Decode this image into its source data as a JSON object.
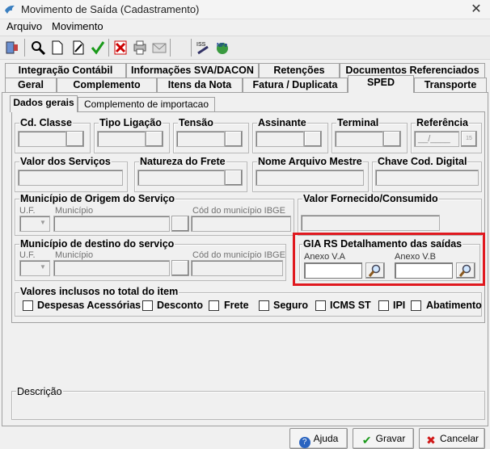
{
  "window": {
    "title": "Movimento de Saída (Cadastramento)",
    "close_glyph": "✕"
  },
  "menu": [
    "Arquivo",
    "Movimento"
  ],
  "toolbar": {
    "icons": [
      "exit-icon",
      "search-icon",
      "new-doc-icon",
      "edit-icon",
      "confirm-icon",
      "delete-icon",
      "print-icon",
      "mail-icon",
      "blank-icon",
      "iss-icon",
      "nfe-icon"
    ],
    "iss_label": "ISS",
    "nfe_label": "NFe"
  },
  "tabs_row1": [
    "Integração Contábil",
    "Informações SVA/DACON",
    "Retenções",
    "Documentos Referenciados"
  ],
  "tabs_row2": [
    "Geral",
    "Complemento",
    "Itens da Nota",
    "Fatura / Duplicata",
    "SPED",
    "Transporte"
  ],
  "active_tab": "SPED",
  "subtabs": [
    "Dados gerais",
    "Complemento de importacao"
  ],
  "fields_row1": {
    "cd_classe": "Cd. Classe",
    "tipo_ligacao": "Tipo Ligação",
    "tensao": "Tensão",
    "assinante": "Assinante",
    "terminal": "Terminal",
    "referencia": "Referência",
    "referencia_value": "__/____",
    "referencia_spin": "15"
  },
  "fields_row2": {
    "valor_servicos": "Valor dos Serviços",
    "natureza_frete": "Natureza do Frete",
    "nome_arquivo": "Nome Arquivo Mestre",
    "chave_cod": "Chave Cod. Digital"
  },
  "municipio_origem": {
    "title": "Município de Origem do Serviço",
    "uf": "U.F.",
    "municipio": "Município",
    "cod_ibge": "Cód do município IBGE"
  },
  "valor_fornecido": "Valor Fornecido/Consumido",
  "municipio_destino": {
    "title": "Município de destino do serviço",
    "uf": "U.F.",
    "municipio": "Município",
    "cod_ibge": "Cód do município IBGE"
  },
  "gia": {
    "title": "GIA RS Detalhamento das saídas",
    "anexo_va": "Anexo V.A",
    "anexo_vb": "Anexo V.B",
    "anexo_va_value": "",
    "anexo_vb_value": ""
  },
  "valores_inclusos": {
    "title": "Valores inclusos no total do item",
    "items": [
      "Despesas Acessórias",
      "Desconto",
      "Frete",
      "Seguro",
      "ICMS ST",
      "IPI",
      "Abatimento"
    ]
  },
  "descricao": {
    "title": "Descrição"
  },
  "buttons": {
    "ajuda": "Ajuda",
    "gravar": "Gravar",
    "cancelar": "Cancelar"
  },
  "colors": {
    "highlight": "#e0191f",
    "field_bg": "#ffffff"
  }
}
